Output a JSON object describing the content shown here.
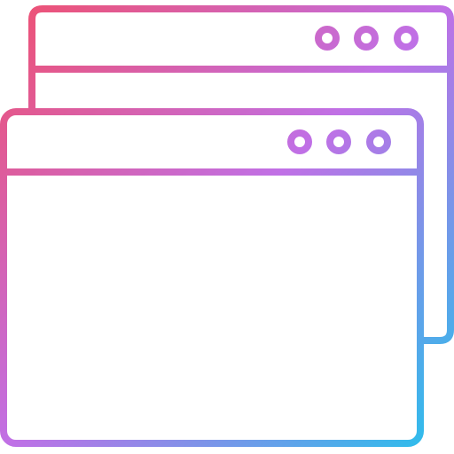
{
  "icon": {
    "name": "multiple-windows-icon",
    "style": "gradient-outline",
    "gradient": {
      "start_color": "#F0506E",
      "middle_color": "#C070E6",
      "end_color": "#22C3EC"
    },
    "stroke_color_fallback": "#C070E6",
    "windows": [
      {
        "name": "back-window",
        "title_bar_dots": 3
      },
      {
        "name": "front-window",
        "title_bar_dots": 3
      }
    ]
  }
}
